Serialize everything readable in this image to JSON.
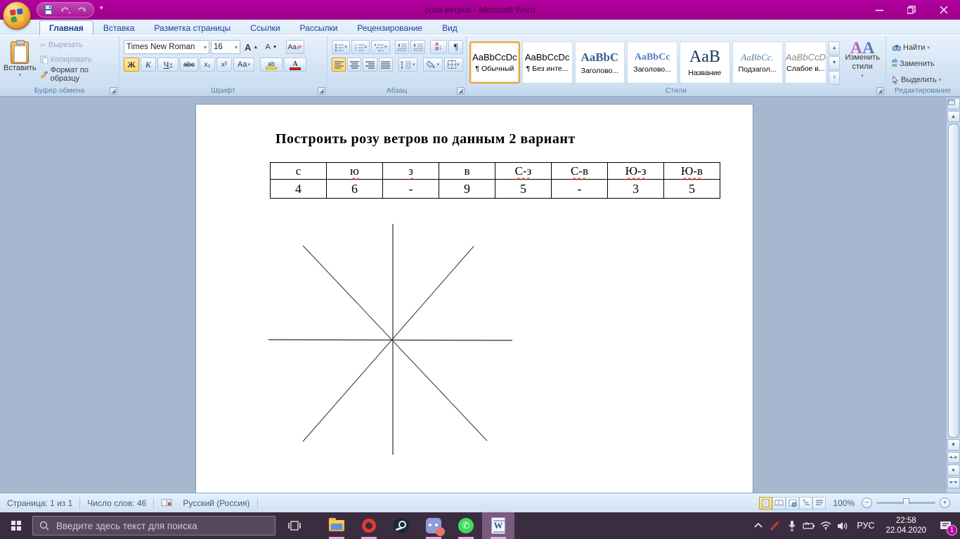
{
  "window": {
    "title": "роза ветров - Microsoft Word"
  },
  "tabs": [
    {
      "label": "Главная",
      "active": true
    },
    {
      "label": "Вставка",
      "active": false
    },
    {
      "label": "Разметка страницы",
      "active": false
    },
    {
      "label": "Ссылки",
      "active": false
    },
    {
      "label": "Рассылки",
      "active": false
    },
    {
      "label": "Рецензирование",
      "active": false
    },
    {
      "label": "Вид",
      "active": false
    }
  ],
  "ribbon": {
    "clipboard": {
      "group_label": "Буфер обмена",
      "paste": "Вставить",
      "cut": "Вырезать",
      "copy": "Копировать",
      "format_painter": "Формат по образцу"
    },
    "font": {
      "group_label": "Шрифт",
      "family": "Times New Roman",
      "size": "16",
      "bold": "Ж",
      "italic": "К",
      "underline": "Ч",
      "strikethrough": "abc",
      "subscript": "x₂",
      "superscript": "x²",
      "change_case": "Aa",
      "clear_format": "Aa",
      "highlight": "ab",
      "font_color": "А"
    },
    "paragraph": {
      "group_label": "Абзац",
      "sort_a": "А",
      "sort_z": "Я",
      "pilcrow": "¶"
    },
    "styles": {
      "group_label": "Стили",
      "items": [
        {
          "sample": "AaBbCcDc",
          "name": "¶ Обычный"
        },
        {
          "sample": "AaBbCcDc",
          "name": "¶ Без инте..."
        },
        {
          "sample": "AaBbC",
          "name": "Заголово..."
        },
        {
          "sample": "AaBbCc",
          "name": "Заголово..."
        },
        {
          "sample": "AaB",
          "name": "Название"
        },
        {
          "sample": "AaBbCc.",
          "name": "Подзагол..."
        },
        {
          "sample": "AaBbCcD",
          "name": "Слабое в..."
        }
      ],
      "change_styles": "Изменить стили"
    },
    "editing": {
      "group_label": "Редактирование",
      "find": "Найти",
      "replace": "Заменить",
      "select": "Выделить",
      "replace_glyph_top": "ab",
      "replace_glyph_bottom": "ac"
    }
  },
  "document": {
    "title": "Построить розу ветров по данным  2 вариант",
    "table": {
      "headers": [
        "с",
        "ю",
        "з",
        "в",
        "С-з",
        "С-в",
        "Ю-з",
        "Ю-в"
      ],
      "values": [
        "4",
        "6",
        "-",
        "9",
        "5",
        "-",
        "3",
        "5"
      ]
    }
  },
  "status": {
    "page": "Страница: 1 из 1",
    "words": "Число слов: 46",
    "language": "Русский (Россия)",
    "zoom_level": "100%"
  },
  "taskbar": {
    "search_placeholder": "Введите здесь текст для поиска",
    "language": "РУС",
    "time": "22:58",
    "date": "22.04.2020",
    "notification_count": "1"
  },
  "colors": {
    "titlebar": "#a8009a",
    "ribbon_bg": "#d4e4f5",
    "active_toggle": "#ffd564",
    "taskbar": "#3b2d40",
    "accent_pink": "#efa9e2"
  }
}
